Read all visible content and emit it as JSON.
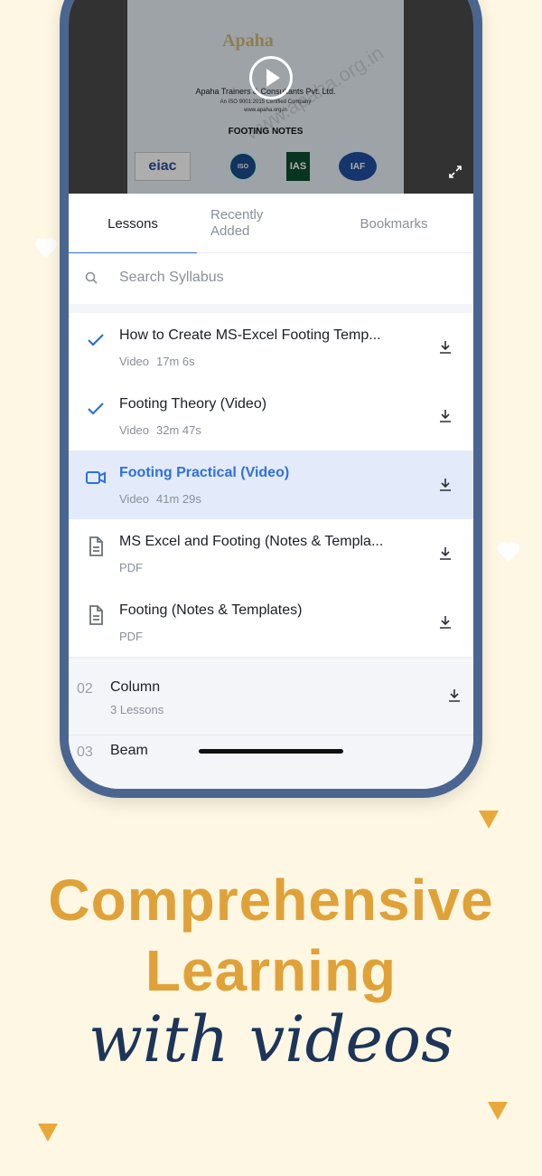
{
  "video": {
    "brand": "Apaha",
    "company": "Apaha Trainers & Consultants Pvt. Ltd.",
    "iso": "An ISO 9001:2015 Certified Company",
    "website": "www.apaha.org.in",
    "watermark": "www.apaha.org.in",
    "slide_title": "FOOTING NOTES",
    "logos": [
      "eiac",
      "ISO",
      "IAS",
      "IAF"
    ]
  },
  "tabs": [
    "Lessons",
    "Recently Added",
    "Bookmarks"
  ],
  "search": {
    "placeholder": "Search Syllabus"
  },
  "lessons": [
    {
      "title": "How to Create MS-Excel Footing Temp...",
      "type": "Video",
      "duration": "17m 6s",
      "status": "completed",
      "icon": "check-icon"
    },
    {
      "title": "Footing Theory (Video)",
      "type": "Video",
      "duration": "32m 47s",
      "status": "completed",
      "icon": "check-icon"
    },
    {
      "title": "Footing Practical (Video)",
      "type": "Video",
      "duration": "41m 29s",
      "status": "playing",
      "icon": "video-camera-icon"
    },
    {
      "title": "MS Excel and Footing (Notes & Templa...",
      "type": "PDF",
      "duration": "",
      "status": "pending",
      "icon": "document-icon"
    },
    {
      "title": "Footing (Notes & Templates)",
      "type": "PDF",
      "duration": "",
      "status": "pending",
      "icon": "document-icon"
    }
  ],
  "modules": [
    {
      "number": "02",
      "title": "Column",
      "subtitle": "3 Lessons"
    },
    {
      "number": "03",
      "title": "Beam",
      "subtitle": ""
    }
  ],
  "tagline": {
    "line1": "Comprehensive",
    "line2": "Learning",
    "line3": "with videos"
  },
  "colors": {
    "background": "#fdf7e3",
    "accent_blue": "#2f6fe0",
    "headline_gold": "#e0a238",
    "script_navy": "#1d3559",
    "phone_frame": "#4a6590"
  }
}
